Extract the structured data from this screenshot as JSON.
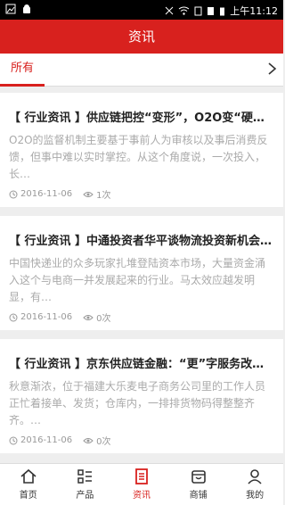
{
  "status": {
    "time": "上午11:12"
  },
  "header": {
    "title": "资讯"
  },
  "tabs": {
    "active_label": "所有"
  },
  "articles": [
    {
      "title": "【 行业资讯 】供应链把控“变形”，O2O变“硬…",
      "summary": "O2O的监督机制主要基于事前人为审核以及事后消费反馈，但事中难以实时掌控。从这个角度说，一次投入，长…",
      "date": "2016-11-06",
      "views": "1次"
    },
    {
      "title": "【 行业资讯 】中通投资者华平谈物流投资新机会…",
      "summary": "中国快递业的众多玩家扎堆登陆资本市场，大量资金涌入这个与电商一并发展起来的行业。马太效应越发明显，有…",
      "date": "2016-11-06",
      "views": "0次"
    },
    {
      "title": "【 行业资讯 】京东供应链金融：“更”字服务改…",
      "summary": "秋意渐浓，位于福建大乐麦电子商务公司里的工作人员正忙着接单、发货；仓库内，一排排货物码得整整齐齐。…",
      "date": "2016-11-06",
      "views": "0次"
    }
  ],
  "nav": [
    {
      "label": "首页",
      "icon": "home-icon"
    },
    {
      "label": "产品",
      "icon": "grid-icon"
    },
    {
      "label": "资讯",
      "icon": "news-icon"
    },
    {
      "label": "商铺",
      "icon": "shop-icon"
    },
    {
      "label": "我的",
      "icon": "user-icon"
    }
  ]
}
